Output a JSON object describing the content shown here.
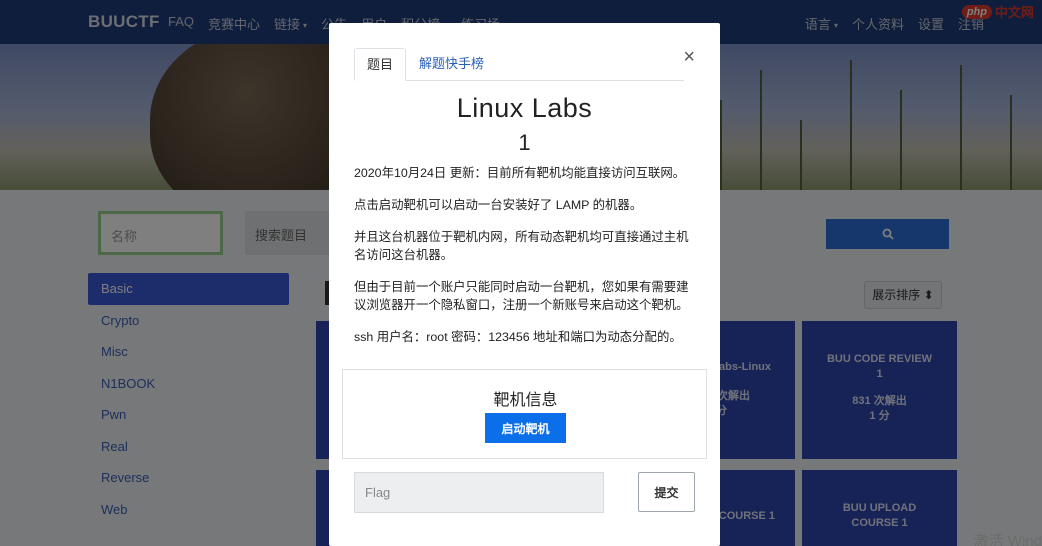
{
  "navbar": {
    "brand": "BUUCTF",
    "left_items": [
      "FAQ",
      "竞赛中心",
      "链接",
      "公告",
      "用户",
      "积分榜",
      "练习场"
    ],
    "right_items": [
      "语言",
      "个人资料",
      "设置",
      "注销"
    ]
  },
  "watermark": {
    "badge": "php",
    "text": "中文网"
  },
  "search": {
    "name_placeholder": "名称",
    "title_placeholder": "搜索题目",
    "button_icon": "search-icon"
  },
  "categories": [
    "Basic",
    "Crypto",
    "Misc",
    "N1BOOK",
    "Pwn",
    "Real",
    "Reverse",
    "Web"
  ],
  "active_category": "Basic",
  "sort_label": "展示排序",
  "cards": [
    {
      "title": "BUU CODE REVIEW",
      "number": "1",
      "solves": "831 次解出",
      "points": "1 分"
    },
    {
      "title": "BUU UPLOAD",
      "subtitle": "COURSE 1"
    }
  ],
  "partial_texts": {
    "labs": "abs-Linux",
    "solved": "次解出",
    "pts": "分",
    "course": "COURSE 1"
  },
  "os_watermark": "激活 Wind",
  "modal": {
    "tabs": [
      "题目",
      "解题快手榜"
    ],
    "close_glyph": "×",
    "challenge_name": "Linux Labs",
    "challenge_score": "1",
    "description": [
      "2020年10月24日 更新：目前所有靶机均能直接访问互联网。",
      "点击启动靶机可以启动一台安装好了 LAMP 的机器。",
      "并且这台机器位于靶机内网，所有动态靶机均可直接通过主机名访问这台机器。",
      "但由于目前一个账户只能同时启动一台靶机，您如果有需要建议浏览器开一个隐私窗口，注册一个新账号来启动这个靶机。",
      "ssh 用户名：root 密码：123456 地址和端口为动态分配的。"
    ],
    "target_title": "靶机信息",
    "start_button": "启动靶机",
    "flag_placeholder": "Flag",
    "submit_button": "提交"
  }
}
